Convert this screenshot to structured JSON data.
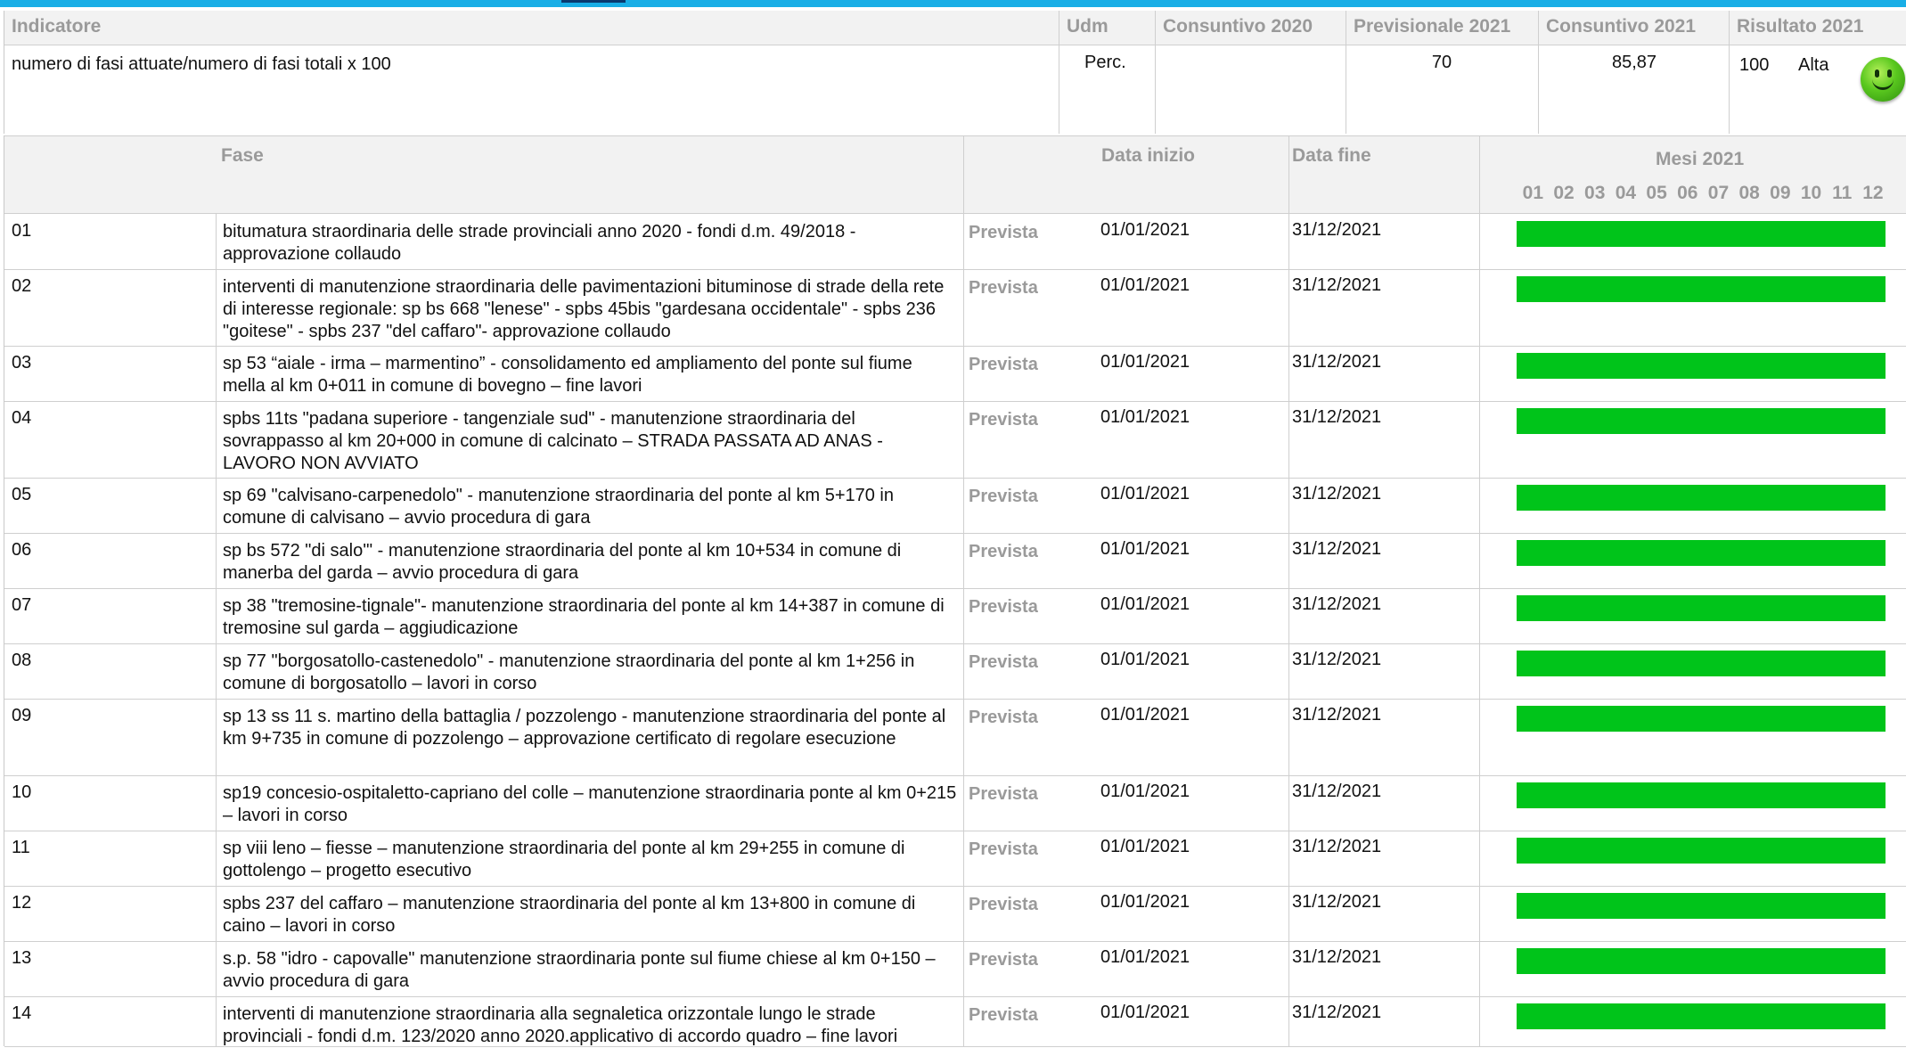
{
  "indicator": {
    "headers": {
      "indicatore": "Indicatore",
      "udm": "Udm",
      "consuntivo_2020": "Consuntivo 2020",
      "previsionale_2021": "Previsionale 2021",
      "consuntivo_2021": "Consuntivo 2021",
      "risultato_2021": "Risultato 2021"
    },
    "row": {
      "name": "numero di fasi attuate/numero di fasi totali x 100",
      "udm": "Perc.",
      "consuntivo_2020": "",
      "previsionale_2021": "70",
      "consuntivo_2021": "85,87",
      "risultato_value": "100",
      "risultato_level": "Alta",
      "risultato_icon": "smiley-icon",
      "icon_color": "#5ac81f"
    }
  },
  "phases": {
    "headers": {
      "fase": "Fase",
      "data_inizio": "Data inizio",
      "data_fine": "Data fine",
      "mesi": "Mesi 2021"
    },
    "months": [
      "01",
      "02",
      "03",
      "04",
      "05",
      "06",
      "07",
      "08",
      "09",
      "10",
      "11",
      "12"
    ],
    "bar_color": "#00c41a",
    "rows": [
      {
        "num": "01",
        "desc": "bitumatura straordinaria delle strade provinciali  anno 2020 - fondi d.m. 49/2018 - approvazione collaudo",
        "status": "Prevista",
        "start": "01/01/2021",
        "end": "31/12/2021",
        "bar_from_month": 1,
        "bar_to_month": 12
      },
      {
        "num": "02",
        "desc": "interventi di manutenzione straordinaria delle pavimentazioni bituminose di strade della rete di interesse regionale: sp bs 668 \"lenese\" - spbs 45bis \"gardesana occidentale\" - spbs 236 \"goitese\" - spbs 237 \"del caffaro\"- approvazione collaudo",
        "status": "Prevista",
        "start": "01/01/2021",
        "end": "31/12/2021",
        "bar_from_month": 1,
        "bar_to_month": 12
      },
      {
        "num": "03",
        "desc": "sp 53 “aiale - irma – marmentino” - consolidamento ed ampliamento del ponte sul fiume mella al km 0+011 in comune di bovegno – fine lavori",
        "status": "Prevista",
        "start": "01/01/2021",
        "end": "31/12/2021",
        "bar_from_month": 1,
        "bar_to_month": 12
      },
      {
        "num": "04",
        "desc": "spbs 11ts \"padana superiore - tangenziale sud\" - manutenzione straordinaria del sovrappasso al km 20+000 in comune di calcinato – STRADA PASSATA AD ANAS - LAVORO NON AVVIATO",
        "status": "Prevista",
        "start": "01/01/2021",
        "end": "31/12/2021",
        "bar_from_month": 1,
        "bar_to_month": 12
      },
      {
        "num": "05",
        "desc": "sp 69 \"calvisano-carpenedolo\" - manutenzione straordinaria del ponte al km 5+170 in comune di calvisano – avvio procedura di gara",
        "status": "Prevista",
        "start": "01/01/2021",
        "end": "31/12/2021",
        "bar_from_month": 1,
        "bar_to_month": 12
      },
      {
        "num": "06",
        "desc": "sp bs 572 \"di salo'\" - manutenzione straordinaria del ponte al km 10+534 in comune di manerba del garda – avvio procedura di gara",
        "status": "Prevista",
        "start": "01/01/2021",
        "end": "31/12/2021",
        "bar_from_month": 1,
        "bar_to_month": 12
      },
      {
        "num": "07",
        "desc": "sp 38 \"tremosine-tignale\"- manutenzione straordinaria del ponte al km 14+387 in comune di tremosine sul garda – aggiudicazione",
        "status": "Prevista",
        "start": "01/01/2021",
        "end": "31/12/2021",
        "bar_from_month": 1,
        "bar_to_month": 12
      },
      {
        "num": "08",
        "desc": "sp 77 \"borgosatollo-castenedolo\" - manutenzione straordinaria del ponte al km 1+256 in comune di borgosatollo – lavori in corso",
        "status": "Prevista",
        "start": "01/01/2021",
        "end": "31/12/2021",
        "bar_from_month": 1,
        "bar_to_month": 12
      },
      {
        "num": "09",
        "desc": "sp 13 ss 11 s. martino della battaglia / pozzolengo - manutenzione straordinaria del ponte al km 9+735 in comune di pozzolengo – approvazione certificato di regolare esecuzione",
        "status": "Prevista",
        "start": "01/01/2021",
        "end": "31/12/2021",
        "bar_from_month": 1,
        "bar_to_month": 12
      },
      {
        "num": "10",
        "desc": "sp19 concesio-ospitaletto-capriano del colle – manutenzione straordinaria ponte al km 0+215 – lavori in corso",
        "status": "Prevista",
        "start": "01/01/2021",
        "end": "31/12/2021",
        "bar_from_month": 1,
        "bar_to_month": 12
      },
      {
        "num": "11",
        "desc": "sp viii leno – fiesse – manutenzione straordinaria del ponte al km 29+255 in comune di gottolengo – progetto esecutivo",
        "status": "Prevista",
        "start": "01/01/2021",
        "end": "31/12/2021",
        "bar_from_month": 1,
        "bar_to_month": 12
      },
      {
        "num": "12",
        "desc": "spbs 237 del caffaro – manutenzione straordinaria del ponte al km 13+800 in comune di caino – lavori in corso",
        "status": "Prevista",
        "start": "01/01/2021",
        "end": "31/12/2021",
        "bar_from_month": 1,
        "bar_to_month": 12
      },
      {
        "num": "13",
        "desc": "s.p. 58 \"idro - capovalle\" manutenzione straordinaria ponte sul fiume chiese al km 0+150 – avvio procedura di gara",
        "status": "Prevista",
        "start": "01/01/2021",
        "end": "31/12/2021",
        "bar_from_month": 1,
        "bar_to_month": 12
      },
      {
        "num": "14",
        "desc": "interventi di manutenzione straordinaria alla segnaletica orizzontale lungo le strade provinciali - fondi d.m. 123/2020 anno 2020.applicativo di accordo quadro – fine lavori",
        "status": "Prevista",
        "start": "01/01/2021",
        "end": "31/12/2021",
        "bar_from_month": 1,
        "bar_to_month": 12
      }
    ]
  }
}
